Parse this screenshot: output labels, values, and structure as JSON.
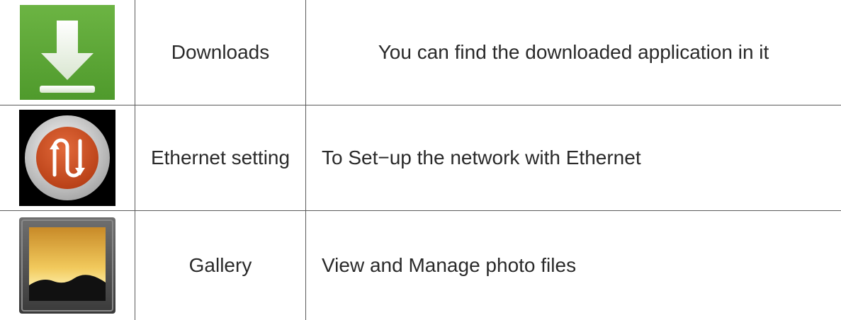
{
  "rows": [
    {
      "name": "Downloads",
      "description": "You can find the downloaded application in it",
      "icon": "download-icon",
      "icon_color": "#5fa93a"
    },
    {
      "name": "Ethernet setting",
      "description": "To Set−up the network with Ethernet",
      "icon": "ethernet-icon",
      "icon_color": "#c84a1e"
    },
    {
      "name": "Gallery",
      "description": "View and Manage photo files",
      "icon": "gallery-icon",
      "icon_color": "#e8b84a"
    }
  ]
}
